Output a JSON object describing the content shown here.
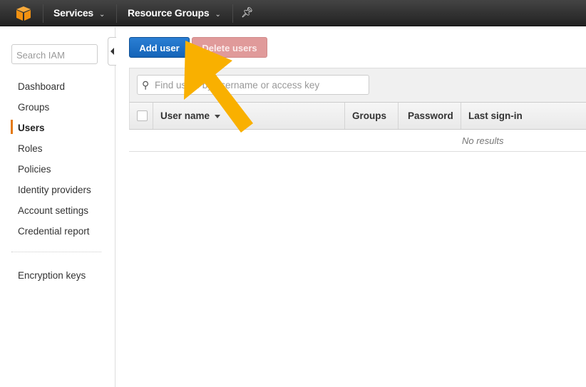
{
  "topbar": {
    "logo_icon": "aws-cube-icon",
    "services_label": "Services",
    "resource_groups_label": "Resource Groups",
    "pin_icon": "pin-icon",
    "chevron": "⌄"
  },
  "sidebar": {
    "search_placeholder": "Search IAM",
    "items": [
      {
        "label": "Dashboard",
        "active": false
      },
      {
        "label": "Groups",
        "active": false
      },
      {
        "label": "Users",
        "active": true
      },
      {
        "label": "Roles",
        "active": false
      },
      {
        "label": "Policies",
        "active": false
      },
      {
        "label": "Identity providers",
        "active": false
      },
      {
        "label": "Account settings",
        "active": false
      },
      {
        "label": "Credential report",
        "active": false
      }
    ],
    "secondary_items": [
      {
        "label": "Encryption keys"
      }
    ]
  },
  "toolbar": {
    "add_user_label": "Add user",
    "delete_users_label": "Delete users"
  },
  "table": {
    "filter_placeholder": "Find users by username or access key",
    "columns": [
      "User name",
      "Groups",
      "Password",
      "Last sign-in"
    ],
    "sorted_column": "User name",
    "empty_text": "No results"
  },
  "annotation": {
    "arrow_color": "#F9B000",
    "points_to": "Add user"
  },
  "colors": {
    "accent_orange": "#E47911",
    "primary_blue": "#1E6FC8",
    "disabled_red": "#E09A9A"
  }
}
